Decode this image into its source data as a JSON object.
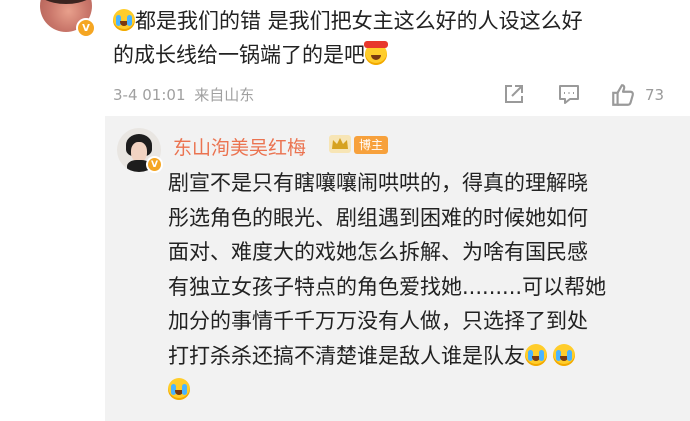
{
  "comment": {
    "text_line1": "都是我们的错 是我们把女主这么好的人设这么好",
    "text_line2": "的成长线给一锅端了的是吧",
    "date": "3-4 01:01",
    "source": "来自山东",
    "like_count": "73",
    "verified_badge": "V"
  },
  "reply": {
    "author": "东山洵美吴红梅",
    "blogger_tag": "博主",
    "verified_badge": "V",
    "lines": [
      "剧宣不是只有瞎嚷嚷闹哄哄的，得真的理解晓",
      "彤选角色的眼光、剧组遇到困难的时候她如何",
      "面对、难度大的戏她怎么拆解、为啥有国民感",
      "有独立女孩子特点的角色爱找她.........可以帮她",
      "加分的事情千千万万没有人做，只选择了到处",
      "打打杀杀还搞不清楚谁是敌人谁是队友"
    ]
  },
  "icons": {
    "crying": "crying-emoji-icon",
    "laughing": "laughing-red-emoji-icon",
    "share": "share-icon",
    "comment": "comment-icon",
    "like": "thumbs-up-icon",
    "crown": "crown-icon"
  },
  "colors": {
    "author_name": "#eb7350",
    "blogger_tag_bg": "#f7a13c",
    "verified_badge": "#f5a623",
    "meta_gray": "#a0a0a0",
    "reply_bg": "#f2f2f2"
  }
}
